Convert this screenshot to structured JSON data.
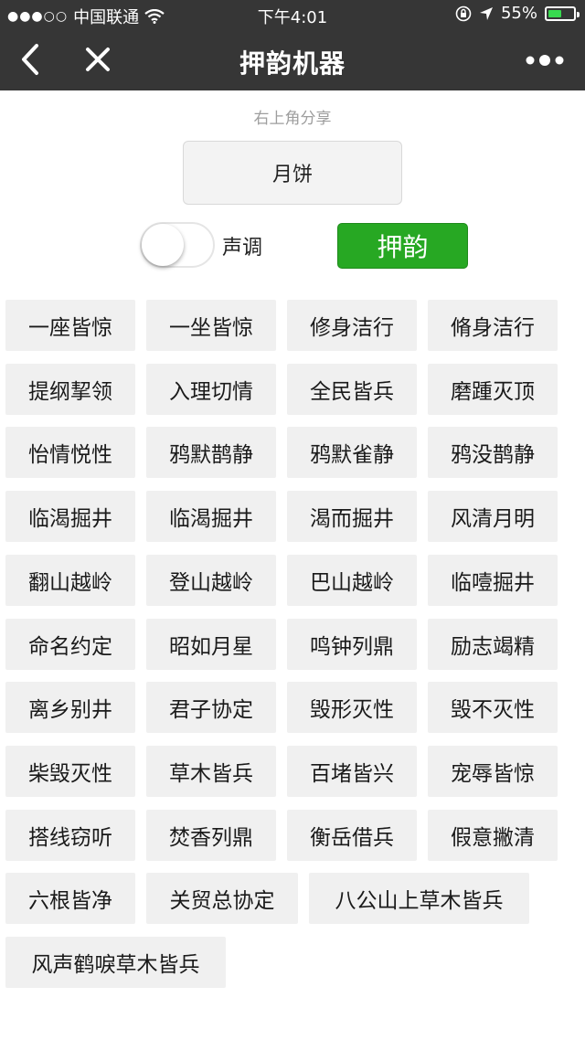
{
  "status_bar": {
    "signal_dots": "●●●○○",
    "carrier": "中国联通",
    "time": "下午4:01",
    "battery": "55%",
    "battery_level": 0.55,
    "battery_color": "#38d94f"
  },
  "nav": {
    "title": "押韵机器"
  },
  "hint": "右上角分享",
  "input": {
    "value": "月饼"
  },
  "toggle": {
    "label": "声调",
    "on": false
  },
  "rhyme_button": "押韵",
  "results": [
    "一座皆惊",
    "一坐皆惊",
    "修身洁行",
    "脩身洁行",
    "提纲挈领",
    "入理切情",
    "全民皆兵",
    "磨踵灭顶",
    "怡情悦性",
    "鸦默鹊静",
    "鸦默雀静",
    "鸦没鹊静",
    "临渴掘井",
    "临渴掘井",
    "渴而掘井",
    "风清月明",
    "翻山越岭",
    "登山越岭",
    "巴山越岭",
    "临噎掘井",
    "命名约定",
    "昭如月星",
    "鸣钟列鼎",
    "励志竭精",
    "离乡别井",
    "君子协定",
    "毁形灭性",
    "毁不灭性",
    "柴毁灭性",
    "草木皆兵",
    "百堵皆兴",
    "宠辱皆惊",
    "搭线窃听",
    "焚香列鼎",
    "衡岳借兵",
    "假意撇清",
    "六根皆净",
    "关贸总协定",
    "八公山上草木皆兵",
    "风声鹤唳草木皆兵"
  ]
}
